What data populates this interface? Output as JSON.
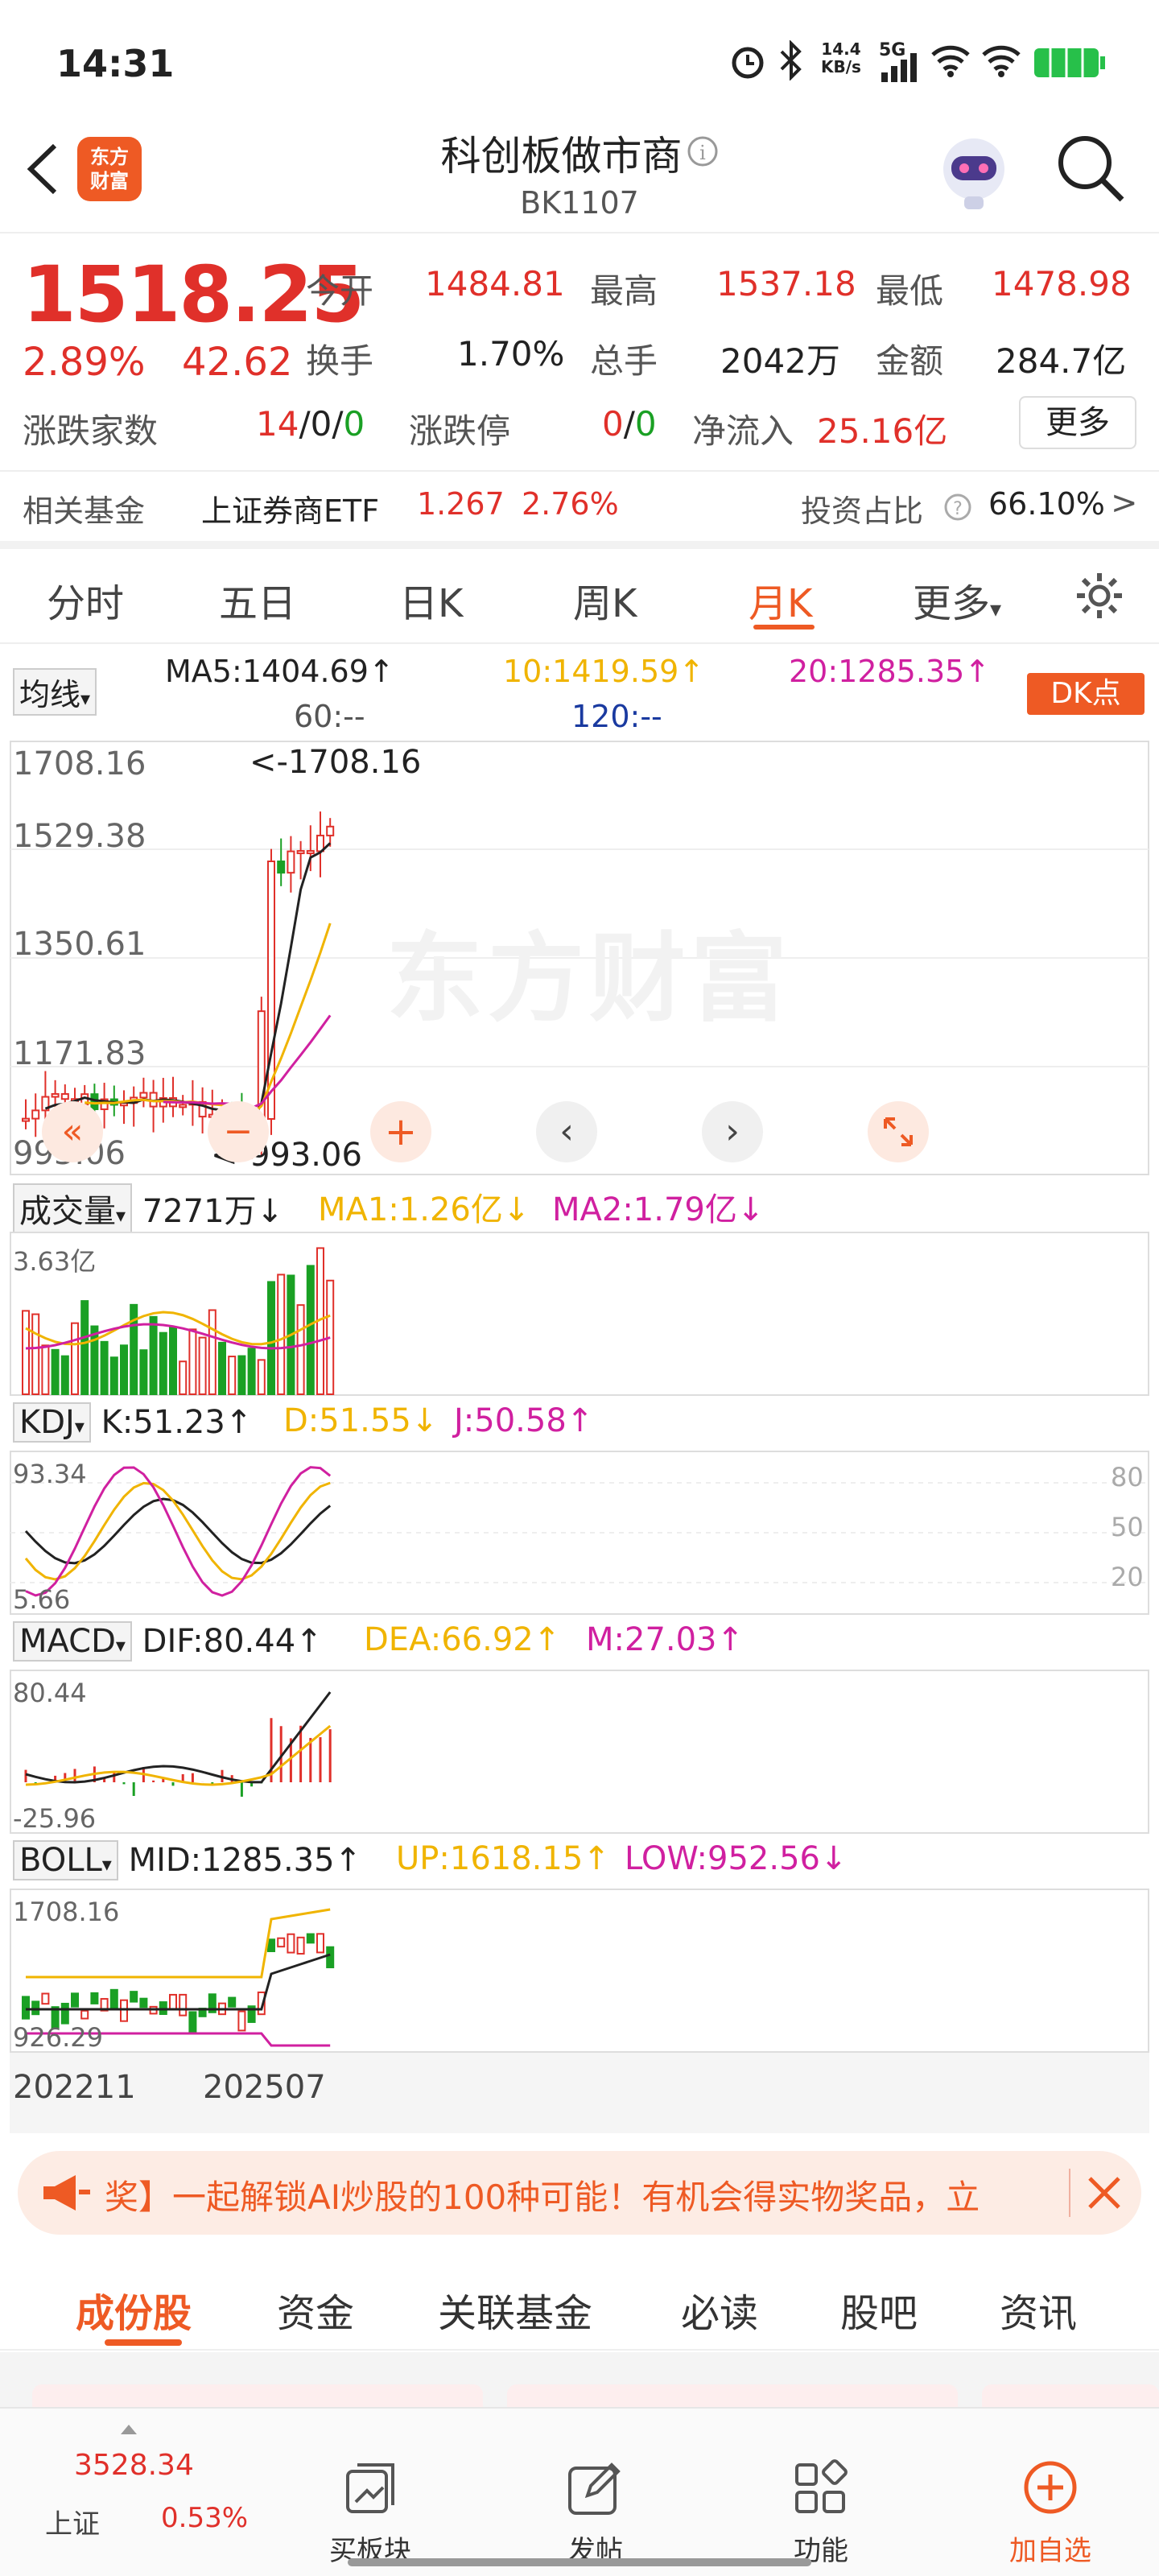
{
  "status_bar": {
    "time": "14:31",
    "speed_top": "14.4",
    "speed_bottom": "KB/s",
    "network": "5G"
  },
  "header": {
    "title": "科创板做市商",
    "code": "BK1107",
    "logo_line1": "东方",
    "logo_line2": "财富"
  },
  "quote": {
    "price": "1518.25",
    "change_pct": "2.89%",
    "change_abs": "42.62",
    "open_label": "今开",
    "open": "1484.81",
    "high_label": "最高",
    "high": "1537.18",
    "low_label": "最低",
    "low": "1478.98",
    "turnover_label": "换手",
    "turnover": "1.70%",
    "volume_label": "总手",
    "volume": "2042万",
    "amount_label": "金额",
    "amount": "284.7亿",
    "updown_label": "涨跌家数",
    "up_count": "14",
    "sep1": "/",
    "flat_count": "0",
    "sep2": "/",
    "down_count": "0",
    "limit_label": "涨跌停",
    "limit_up": "0",
    "sep3": "/",
    "limit_down": "0",
    "inflow_label": "净流入",
    "inflow": "25.16亿",
    "more_label": "更多"
  },
  "fund_row": {
    "label": "相关基金",
    "fund_name": "上证券商ETF",
    "fund_price": "1.267",
    "fund_pct": "2.76%",
    "ratio_label": "投资占比",
    "ratio": "66.10%",
    "arrow": ">"
  },
  "tabs": {
    "items": [
      "分时",
      "五日",
      "日K",
      "周K",
      "月K",
      "更多"
    ],
    "active": "月K",
    "more_caret": "▾"
  },
  "ma_row": {
    "selector": "均线",
    "ma5": "MA5:1404.69",
    "ma10": "10:1419.59",
    "ma20": "20:1285.35",
    "ma60": "60:--",
    "ma120": "120:--",
    "dk": "DK点",
    "up": "↑"
  },
  "kchart": {
    "y_labels": [
      "1708.16",
      "1529.38",
      "1350.61",
      "1171.83",
      "993.06"
    ],
    "max_marker": "<-1708.16",
    "min_marker": "<-993.06",
    "watermark": "东方财富"
  },
  "volume_panel": {
    "selector": "成交量",
    "value": "7271万",
    "ma1": "MA1:1.26亿",
    "ma2": "MA2:1.79亿",
    "y_top": "3.63亿",
    "down": "↓"
  },
  "kdj_panel": {
    "selector": "KDJ",
    "k": "K:51.23",
    "d": "D:51.55",
    "j": "J:50.58",
    "y_top": "93.34",
    "y_bottom": "5.66",
    "levels": [
      "80",
      "50",
      "20"
    ]
  },
  "macd_panel": {
    "selector": "MACD",
    "dif": "DIF:80.44",
    "dea": "DEA:66.92",
    "m": "M:27.03",
    "y_top": "80.44",
    "y_bottom": "-25.96"
  },
  "boll_panel": {
    "selector": "BOLL",
    "mid": "MID:1285.35",
    "up_val": "UP:1618.15",
    "low_val": "LOW:952.56",
    "y_top": "1708.16",
    "y_bottom": "926.29"
  },
  "x_axis": {
    "start": "202211",
    "end": "202507"
  },
  "banner": {
    "text": "奖】一起解锁AI炒股的100种可能！有机会得实物奖品，立"
  },
  "content_tabs": {
    "items": [
      "成份股",
      "资金",
      "关联基金",
      "必读",
      "股吧",
      "资讯"
    ],
    "active": "成份股"
  },
  "footer": {
    "index_value": "3528.34",
    "index_name": "上证",
    "index_pct": "0.53%",
    "items": [
      "买板块",
      "发帖",
      "功能",
      "加自选"
    ]
  },
  "colors": {
    "up": "#e0302a",
    "down": "#1aa024",
    "accent": "#ee5a24",
    "ma10": "#f0b400",
    "ma20": "#d020a0"
  }
}
